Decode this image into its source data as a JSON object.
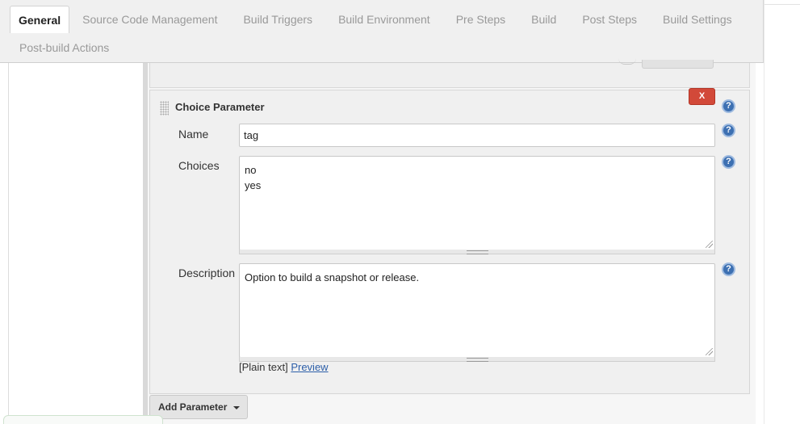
{
  "tabs": {
    "row1": [
      "General",
      "Source Code Management",
      "Build Triggers",
      "Build Environment",
      "Pre Steps",
      "Build",
      "Post Steps",
      "Build Settings"
    ],
    "row2": [
      "Post-build Actions"
    ],
    "active": "General"
  },
  "parameter": {
    "title": "Choice Parameter",
    "delete_label": "X",
    "help_glyph": "?",
    "name_label": "Name",
    "name_value": "tag",
    "choices_label": "Choices",
    "choices": [
      "no",
      "yes"
    ],
    "description_label": "Description",
    "description_value": "Option to build a snapshot or release.",
    "plain_text": "[Plain text]",
    "preview_link": "Preview"
  },
  "actions": {
    "add_parameter": "Add Parameter"
  },
  "colors": {
    "delete": "#d24939",
    "help": "#3d70b2",
    "link": "#2c5ea8"
  }
}
